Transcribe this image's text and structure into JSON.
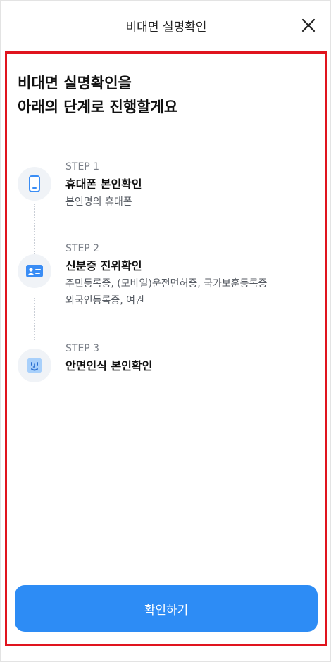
{
  "header": {
    "title": "비대면 실명확인",
    "close_icon": "close-icon"
  },
  "headline": {
    "line1": "비대면 실명확인을",
    "line2": "아래의 단계로 진행할게요"
  },
  "steps": [
    {
      "label": "STEP 1",
      "title": "휴대폰 본인확인",
      "desc_lines": [
        "본인명의 휴대폰"
      ],
      "icon": "phone-icon"
    },
    {
      "label": "STEP 2",
      "title": "신분증 진위확인",
      "desc_lines": [
        "주민등록증, (모바일)운전면허증, 국가보훈등록증",
        "외국인등록증, 여권"
      ],
      "icon": "id-card-icon"
    },
    {
      "label": "STEP 3",
      "title": "안면인식 본인확인",
      "desc_lines": [],
      "icon": "face-icon"
    }
  ],
  "confirm_button": {
    "label": "확인하기"
  },
  "colors": {
    "accent": "#2d8cf5",
    "highlight_border": "#e0141e",
    "icon_bg": "#f0f3f7",
    "icon_blue": "#3a8df5",
    "icon_light_blue": "#a8d0fb"
  }
}
